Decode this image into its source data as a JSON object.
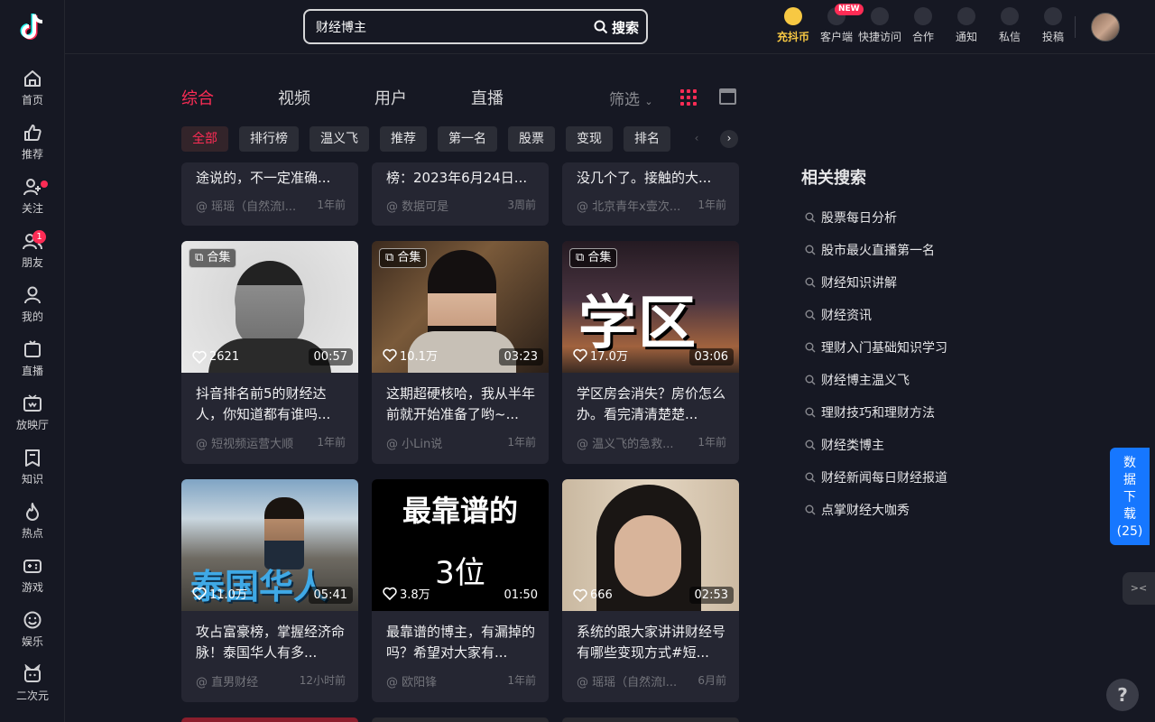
{
  "sidebar": {
    "items": [
      {
        "label": "首页",
        "icon": "home-icon"
      },
      {
        "label": "推荐",
        "icon": "thumb-up-icon"
      },
      {
        "label": "关注",
        "icon": "follow-icon"
      },
      {
        "label": "朋友",
        "icon": "friends-icon",
        "badge": "1"
      },
      {
        "label": "我的",
        "icon": "user-icon"
      },
      {
        "label": "直播",
        "icon": "live-icon"
      },
      {
        "label": "放映厅",
        "icon": "tv-icon"
      },
      {
        "label": "知识",
        "icon": "book-icon"
      },
      {
        "label": "热点",
        "icon": "flame-icon"
      },
      {
        "label": "游戏",
        "icon": "gamepad-icon"
      },
      {
        "label": "娱乐",
        "icon": "smile-icon"
      },
      {
        "label": "二次元",
        "icon": "anime-icon"
      }
    ]
  },
  "search": {
    "value": "财经博主",
    "button": "搜索"
  },
  "topbar": {
    "coin": "充抖币",
    "client": "客户端",
    "new_badge": "NEW",
    "quick": "快捷访问",
    "coop": "合作",
    "notify": "通知",
    "message": "私信",
    "upload": "投稿"
  },
  "tabs": [
    "综合",
    "视频",
    "用户",
    "直播"
  ],
  "filter": "筛选",
  "chips": [
    "全部",
    "排行榜",
    "温义飞",
    "推荐",
    "第一名",
    "股票",
    "变现",
    "排名"
  ],
  "top_cards": [
    {
      "title": "途说的，不一定准确...",
      "author": "@ 瑶瑶（自然流l...",
      "time": "1年前"
    },
    {
      "title": "榜：2023年6月24日...",
      "author": "@ 数据可是",
      "time": "3周前"
    },
    {
      "title": "没几个了。接触的大...",
      "author": "@ 北京青年x壹次...",
      "time": "1年前"
    }
  ],
  "cards": [
    {
      "tag": "合集",
      "likes": "2621",
      "duration": "00:57",
      "title": "抖音排名前5的财经达人，你知道都有谁吗...",
      "author": "@ 短视频运营大顺",
      "time": "1年前"
    },
    {
      "tag": "合集",
      "likes": "10.1万",
      "duration": "03:23",
      "title": "这期超硬核哈，我从半年前就开始准备了哟~...",
      "author": "@ 小Lin说",
      "time": "1年前"
    },
    {
      "tag": "合集",
      "likes": "17.0万",
      "duration": "03:06",
      "title": "学区房会消失？房价怎么办。看完清清楚楚...",
      "author": "@ 温义飞的急救...",
      "time": "1年前",
      "overlay": "学区"
    },
    {
      "tag": "",
      "likes": "11.0万",
      "duration": "05:41",
      "title": "攻占富豪榜，掌握经济命脉！泰国华人有多...",
      "author": "@ 直男财经",
      "time": "12小时前",
      "overlay": "泰国华人"
    },
    {
      "tag": "",
      "likes": "3.8万",
      "duration": "01:50",
      "title": "最靠谱的博主，有漏掉的吗？希望对大家有...",
      "author": "@ 欧阳锋",
      "time": "1年前",
      "overlay": "最靠谱的",
      "overlay2": "3位"
    },
    {
      "tag": "",
      "likes": "666",
      "duration": "02:53",
      "title": "系统的跟大家讲讲财经号有哪些变现方式#短...",
      "author": "@ 瑶瑶（自然流l...",
      "time": "6月前"
    }
  ],
  "related": {
    "title": "相关搜索",
    "items": [
      "股票每日分析",
      "股市最火直播第一名",
      "财经知识讲解",
      "财经资讯",
      "理财入门基础知识学习",
      "财经博主温义飞",
      "理财技巧和理财方法",
      "财经类博主",
      "财经新闻每日财经报道",
      "点掌财经大咖秀"
    ]
  },
  "download": {
    "label": "数据下载",
    "count": "(25)"
  },
  "help": "?",
  "colors": {
    "accent": "#fe2c55",
    "bg": "#161823",
    "card": "#252632",
    "download": "#1677ff"
  }
}
